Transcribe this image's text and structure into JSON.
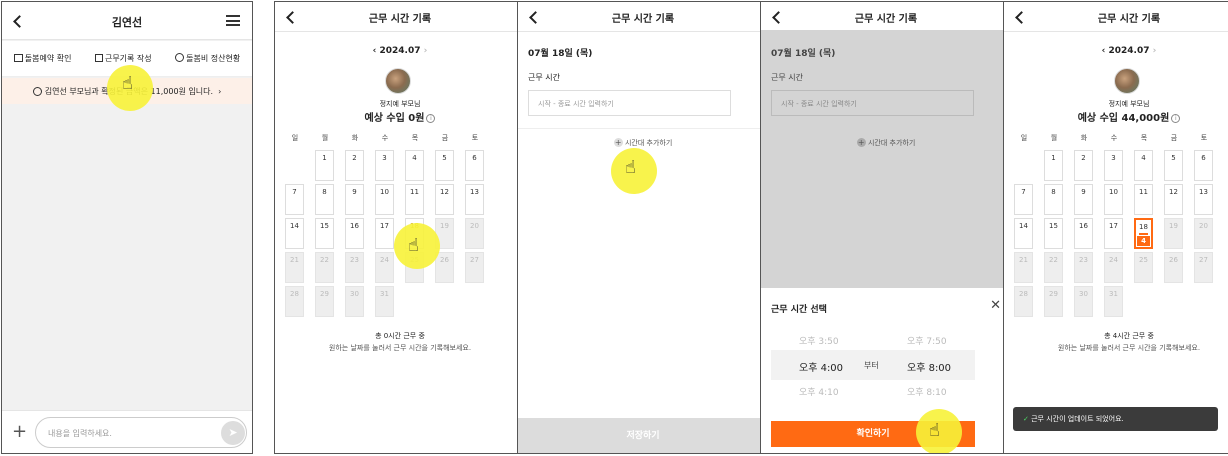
{
  "p1": {
    "title": "김연선",
    "tabs": [
      "돌봄예약 확인",
      "근무기록 작성",
      "돌봄비 정산현황"
    ],
    "banner": "김연선 부모님과 확정된 금액은 11,000원 입니다.",
    "input_placeholder": "내용을 입력하세요."
  },
  "p2": {
    "title": "근무 시간 기록",
    "month": "2024.07",
    "parent_name": "정지예 부모님",
    "income": "예상 수입 0원",
    "summary": "총 0시간 근무 중",
    "hint": "원하는 날짜를 눌러서 근무 시간을 기록해보세요."
  },
  "p3": {
    "title": "근무 시간 기록",
    "date": "07월 18일 (목)",
    "label": "근무 시간",
    "placeholder": "시작 - 종료 시간 입력하기",
    "add": "시간대 추가하기",
    "save": "저장하기"
  },
  "p4": {
    "title": "근무 시간 기록",
    "date": "07월 18일 (목)",
    "label": "근무 시간",
    "placeholder": "시작 - 종료 시간 입력하기",
    "add": "시간대 추가하기",
    "sheet_title": "근무 시간 선택",
    "start_prev": "오후 3:50",
    "start": "오후 4:00",
    "start_next": "오후 4:10",
    "between": "부터",
    "end_prev": "오후 7:50",
    "end": "오후 8:00",
    "end_next": "오후 8:10",
    "confirm": "확인하기"
  },
  "p5": {
    "title": "근무 시간 기록",
    "month": "2024.07",
    "parent_name": "정지예 부모님",
    "income": "예상 수입 44,000원",
    "summary": "총 4시간 근무 중",
    "hint": "원하는 날짜를 눌러서 근무 시간을 기록해보세요.",
    "selected_hours": "4",
    "toast": "근무 시간이 업데이트 되었어요."
  },
  "weekdays": [
    "일",
    "월",
    "화",
    "수",
    "목",
    "금",
    "토"
  ],
  "colors": {
    "accent": "#ff6a13",
    "highlight": "#f7f238"
  }
}
